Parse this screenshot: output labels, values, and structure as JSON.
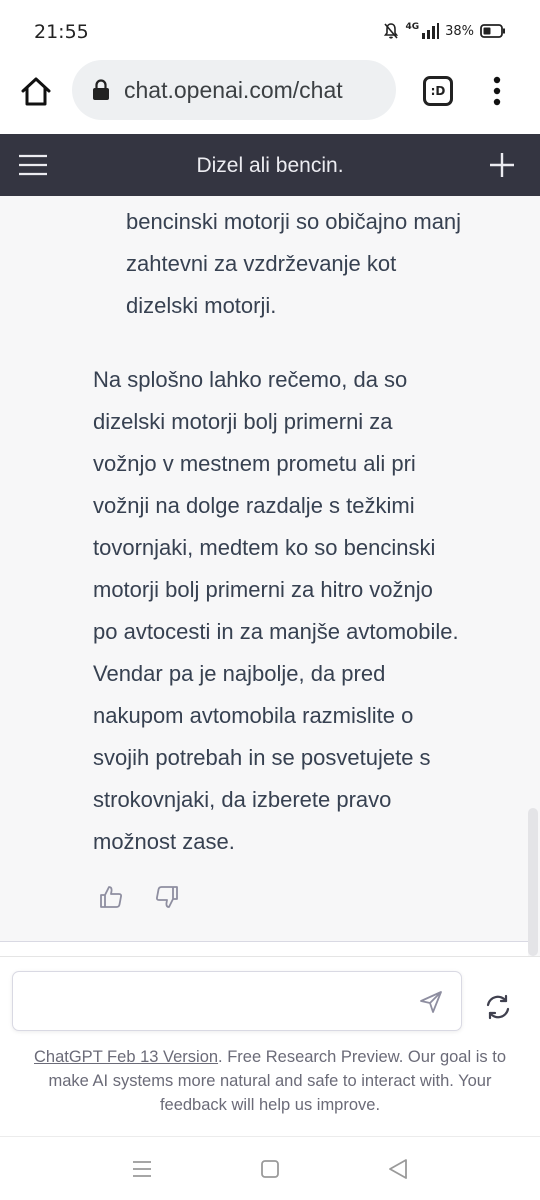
{
  "status_bar": {
    "time": "21:55",
    "network": "4G",
    "battery": "38%"
  },
  "browser": {
    "url": "chat.openai.com/chat",
    "tab_label": ":D"
  },
  "chat": {
    "title": "Dizel ali bencin.",
    "bullet_lines": [
      "bencinski motorji so običajno manj",
      "zahtevni za vzdrževanje kot",
      "dizelski motorji."
    ],
    "paragraph_lines": [
      "Na splošno lahko rečemo, da so",
      "dizelski motorji bolj primerni za",
      "vožnjo v mestnem prometu ali pri",
      "vožnji na dolge razdalje s težkimi",
      "tovornjaki, medtem ko so bencinski",
      "motorji bolj primerni za hitro vožnjo",
      "po avtocesti in za manjše avtomobile.",
      "Vendar pa je najbolje, da pred",
      "nakupom avtomobila razmislite o",
      "svojih potrebah in se posvetujete s",
      "strokovnjaki, da izberete pravo",
      "možnost zase."
    ]
  },
  "input": {
    "value": "",
    "placeholder": ""
  },
  "disclaimer": {
    "version_link": "ChatGPT Feb 13 Version",
    "text": ". Free Research Preview. Our goal is to make AI systems more natural and safe to interact with. Your feedback will help us improve."
  },
  "colors": {
    "header_bg": "#343541",
    "chat_bg": "#f7f7f8",
    "text": "#374151"
  }
}
